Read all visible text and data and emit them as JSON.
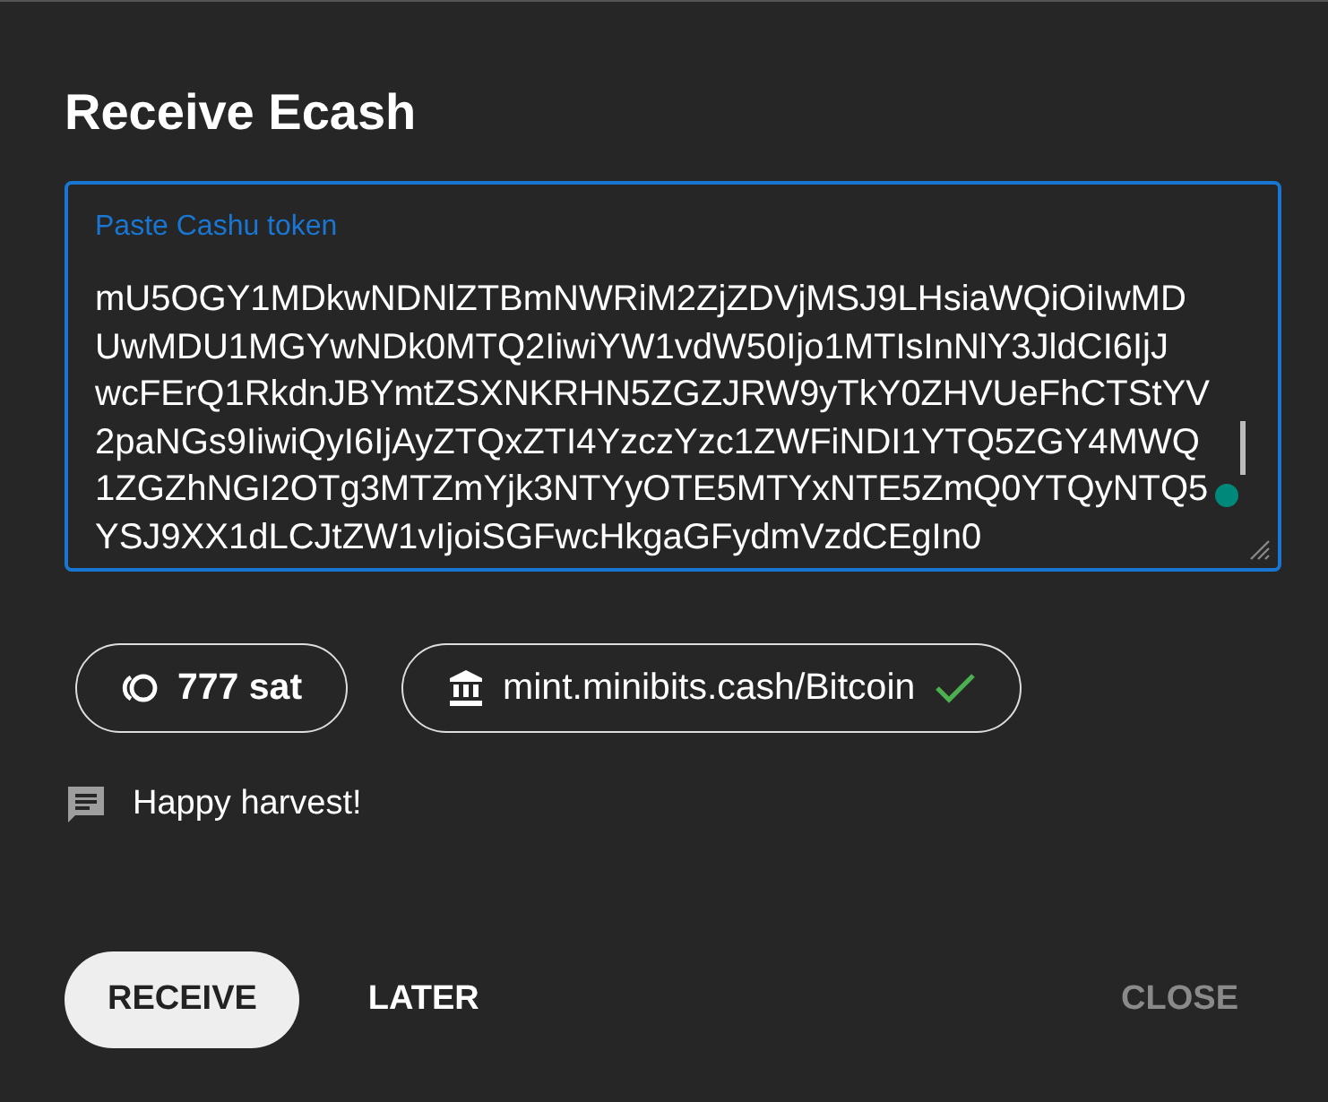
{
  "dialog": {
    "title": "Receive Ecash"
  },
  "token_field": {
    "label": "Paste Cashu token",
    "value_lines": [
      "mU5OGY1MDkwNDNlZTBmNWRiM2ZjZDVjMSJ9LHsiaWQiOiIwMD",
      "UwMDU1MGYwNDk0MTQ2IiwiYW1vdW50Ijo1MTIsInNlY3JldCI6IjJ",
      "wcFErQ1RkdnJBYmtZSXNKRHN5ZGZJRW9yTkY0ZHVUeFhCTStYV",
      "2paNGs9IiwiQyI6IjAyZTQxZTI4YzczYzc1ZWFiNDI1YTQ5ZGY4MWQ",
      "1ZGZhNGI2OTg3MTZmYjk3NTYyOTE5MTYxNTE5ZmQ0YTQyNTQ5",
      "YSJ9XX1dLCJtZW1vIjoiSGFwcHkgaGFydmVzdCEgIn0"
    ]
  },
  "chips": [
    {
      "kind": "amount",
      "text": "777 sat"
    },
    {
      "kind": "mint",
      "text": "mint.minibits.cash/Bitcoin",
      "verified": true
    }
  ],
  "memo": "Happy harvest!",
  "buttons": [
    {
      "label": "RECEIVE",
      "kind": "primary"
    },
    {
      "label": "LATER",
      "kind": "flat"
    },
    {
      "label": "CLOSE",
      "kind": "flat",
      "disabled": true
    }
  ]
}
